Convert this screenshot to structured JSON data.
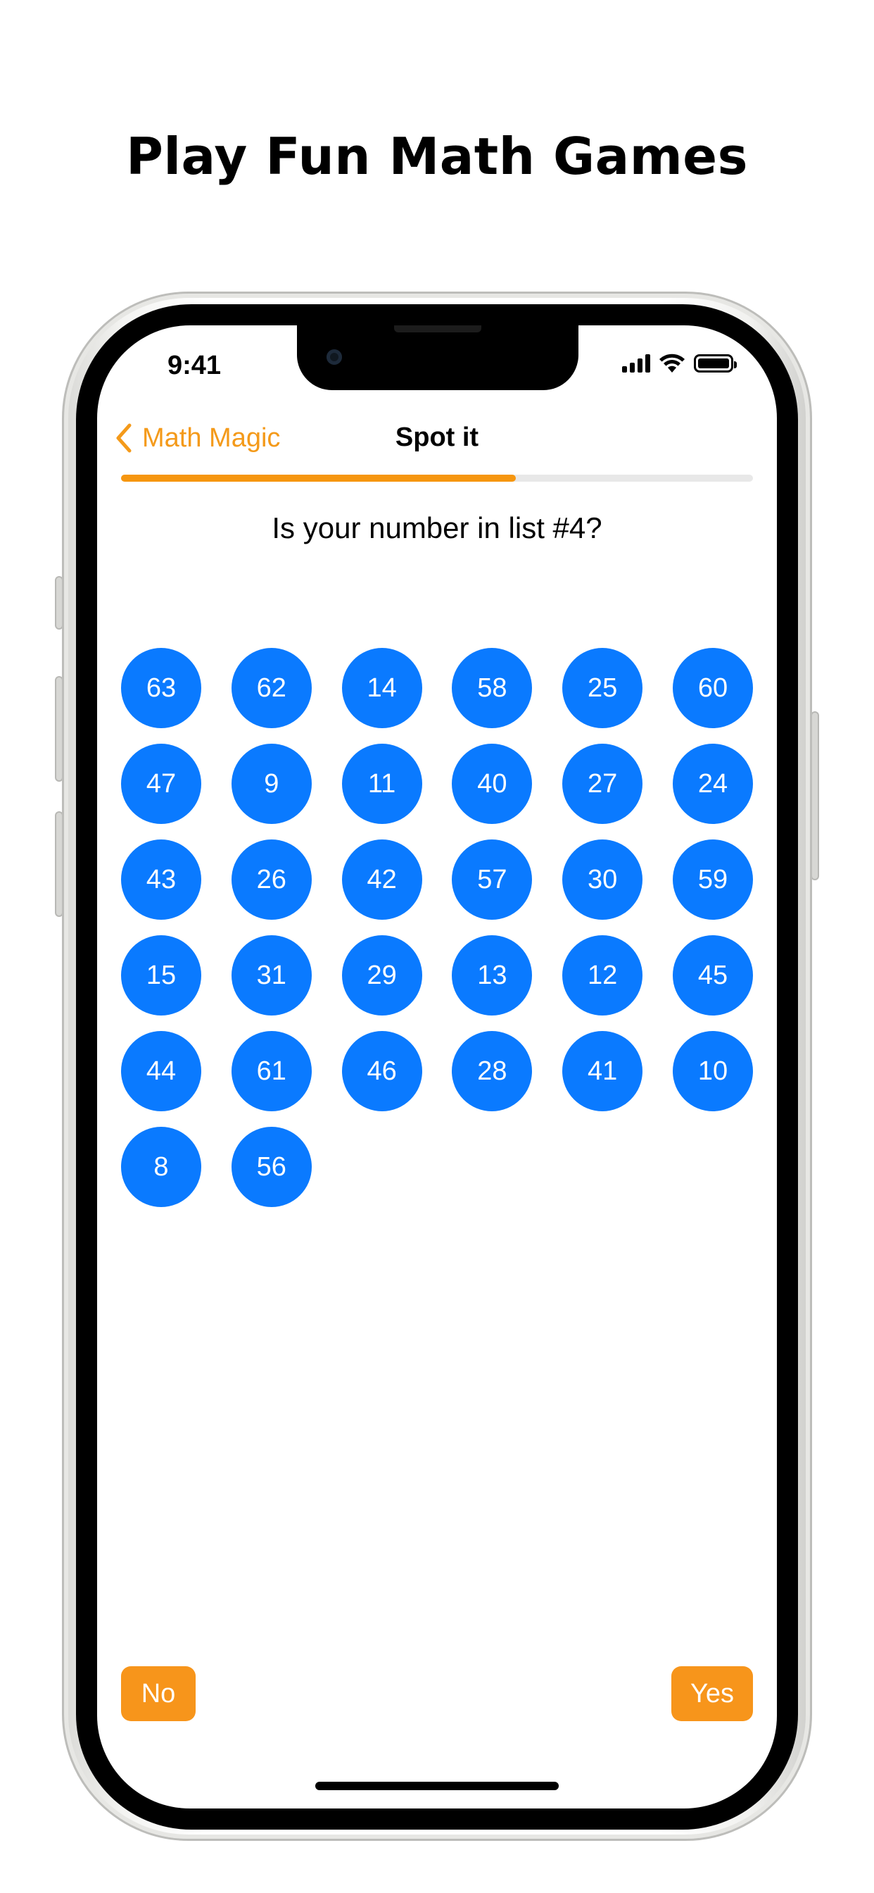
{
  "headline": "Play Fun Math Games",
  "status_bar": {
    "time": "9:41"
  },
  "nav": {
    "back_label": "Math Magic",
    "title": "Spot it"
  },
  "progress": {
    "fraction": 0.625
  },
  "question": "Is your number in list #4?",
  "numbers": [
    "63",
    "62",
    "14",
    "58",
    "25",
    "60",
    "47",
    "9",
    "11",
    "40",
    "27",
    "24",
    "43",
    "26",
    "42",
    "57",
    "30",
    "59",
    "15",
    "31",
    "29",
    "13",
    "12",
    "45",
    "44",
    "61",
    "46",
    "28",
    "41",
    "10",
    "8",
    "56"
  ],
  "buttons": {
    "no": "No",
    "yes": "Yes"
  },
  "colors": {
    "accent": "#f6960f",
    "bubble": "#0a7aff",
    "progress_track": "#e8e8e8"
  },
  "icons": {
    "back": "chevron-left-icon",
    "signal": "cellular-signal-icon",
    "wifi": "wifi-icon",
    "battery": "battery-icon"
  }
}
